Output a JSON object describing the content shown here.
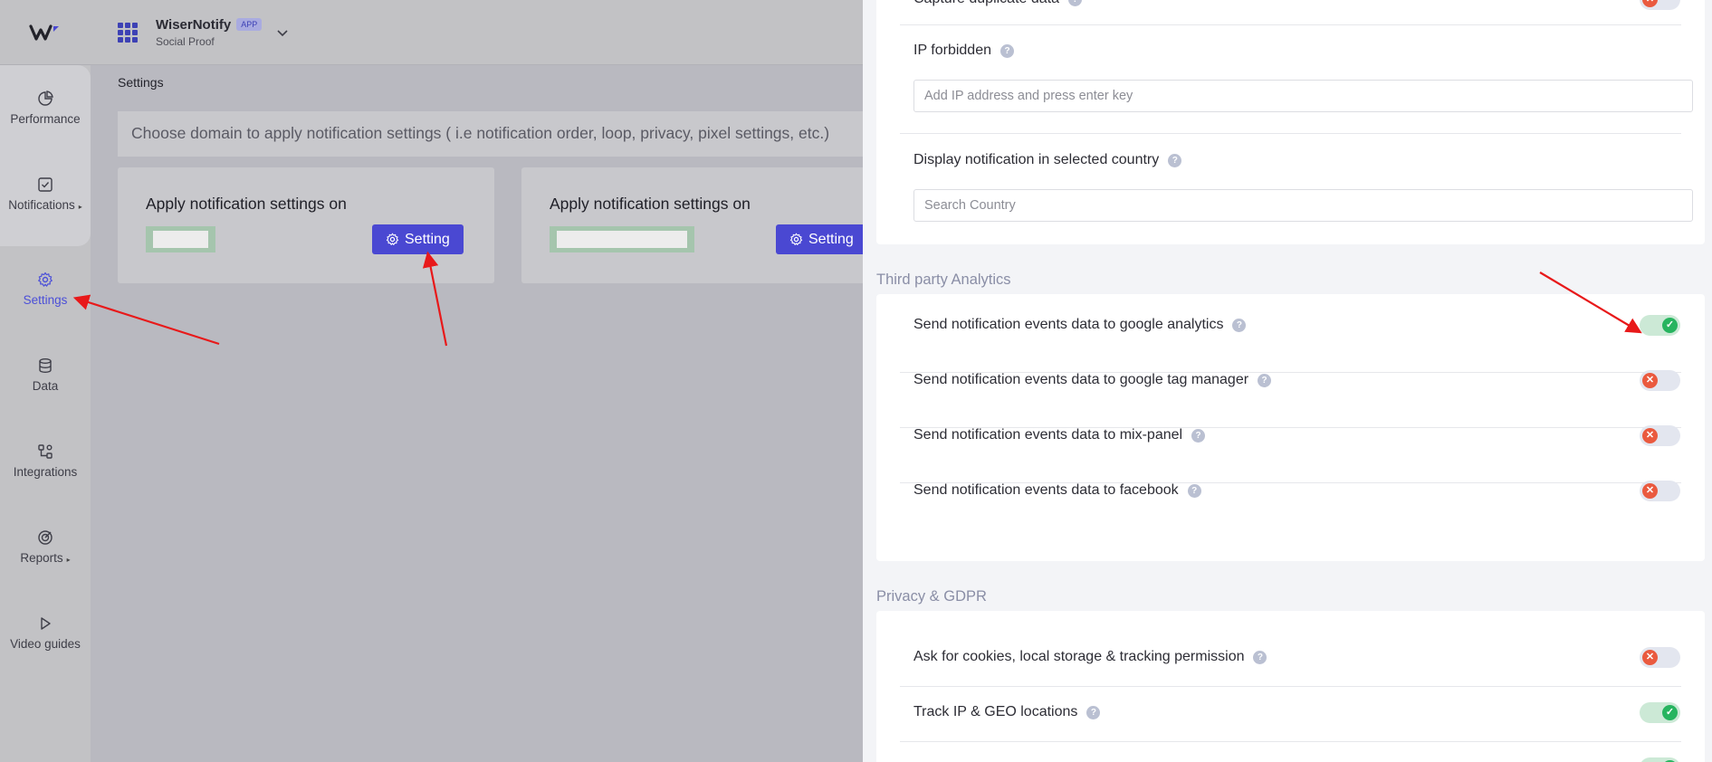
{
  "app": {
    "name": "WiserNotify",
    "badge": "APP",
    "subtitle": "Social Proof"
  },
  "sidebar": {
    "items": [
      {
        "label": "Performance",
        "icon": "pie-chart-icon",
        "caret": ""
      },
      {
        "label": "Notifications",
        "icon": "checkbox-icon",
        "caret": "▸"
      },
      {
        "label": "Settings",
        "icon": "gear-icon",
        "caret": "",
        "active": true
      },
      {
        "label": "Data",
        "icon": "database-icon",
        "caret": ""
      },
      {
        "label": "Integrations",
        "icon": "integrations-icon",
        "caret": ""
      },
      {
        "label": "Reports",
        "icon": "target-icon",
        "caret": "▸"
      },
      {
        "label": "Video guides",
        "icon": "play-icon",
        "caret": ""
      }
    ]
  },
  "main": {
    "title": "Settings",
    "domain_hint": "Choose domain to apply notification settings ( i.e notification order, loop, privacy, pixel settings, etc.)",
    "cards": [
      {
        "title": "Apply notification settings on",
        "button": "Setting"
      },
      {
        "title": "Apply notification settings on",
        "button": "Setting"
      }
    ]
  },
  "drawer": {
    "top_partial_label": "Capture duplicate data",
    "ip_forbidden": {
      "label": "IP forbidden",
      "placeholder": "Add IP address and press enter key"
    },
    "country": {
      "label": "Display notification in selected country",
      "placeholder": "Search Country"
    },
    "analytics": {
      "title": "Third party Analytics",
      "rows": [
        {
          "label": "Send notification events data to google analytics",
          "on": true
        },
        {
          "label": "Send notification events data to google tag manager",
          "on": false
        },
        {
          "label": "Send notification events data to mix-panel",
          "on": false
        },
        {
          "label": "Send notification events data to facebook",
          "on": false
        }
      ]
    },
    "privacy": {
      "title": "Privacy & GDPR",
      "rows": [
        {
          "label": "Ask for cookies, local storage & tracking permission",
          "on": false
        },
        {
          "label": "Track IP & GEO locations",
          "on": true
        }
      ]
    },
    "help_glyph": "?",
    "toggle_on_glyph": "✓",
    "toggle_off_glyph": "✕"
  },
  "colors": {
    "accent": "#4a48d2",
    "toggle_on": "#27b45f",
    "toggle_off": "#ea5a3f",
    "annotation": "#e8191a"
  }
}
